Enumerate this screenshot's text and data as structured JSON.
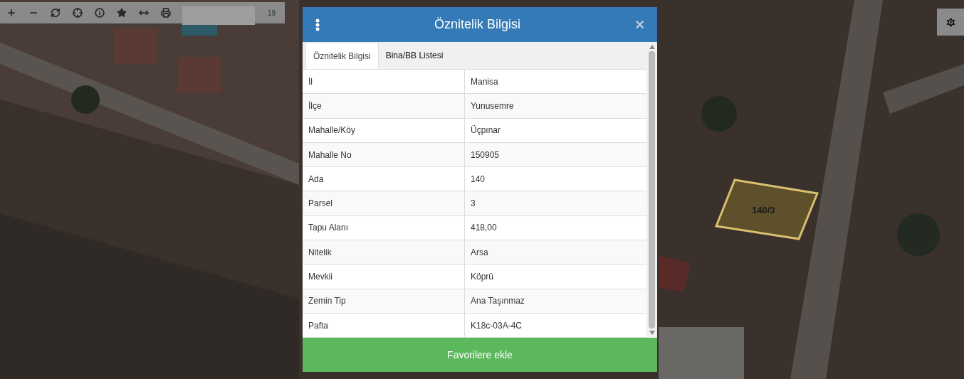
{
  "map": {
    "kind": "picture",
    "parcel_label": "140/3"
  },
  "toolbar": {
    "zoom_level": "19"
  },
  "dialog": {
    "title": "Öznitelik Bilgisi",
    "close": "×",
    "tabs": [
      {
        "label": "Öznitelik Bilgisi",
        "selected": true
      },
      {
        "label": "Bina/BB Listesi",
        "selected": false
      }
    ],
    "rows": [
      {
        "label": "İl",
        "value": "Manisa"
      },
      {
        "label": "İlçe",
        "value": "Yunusemre"
      },
      {
        "label": "Mahalle/Köy",
        "value": "Üçpınar"
      },
      {
        "label": "Mahalle No",
        "value": "150905"
      },
      {
        "label": "Ada",
        "value": "140"
      },
      {
        "label": "Parsel",
        "value": "3"
      },
      {
        "label": "Tapu Alanı",
        "value": "418,00"
      },
      {
        "label": "Nitelik",
        "value": "Arsa"
      },
      {
        "label": "Mevkii",
        "value": "Köprü"
      },
      {
        "label": "Zemin Tip",
        "value": "Ana Taşınmaz"
      },
      {
        "label": "Pafta",
        "value": "K18c-03A-4C"
      }
    ],
    "action": "Favorilere ekle"
  }
}
